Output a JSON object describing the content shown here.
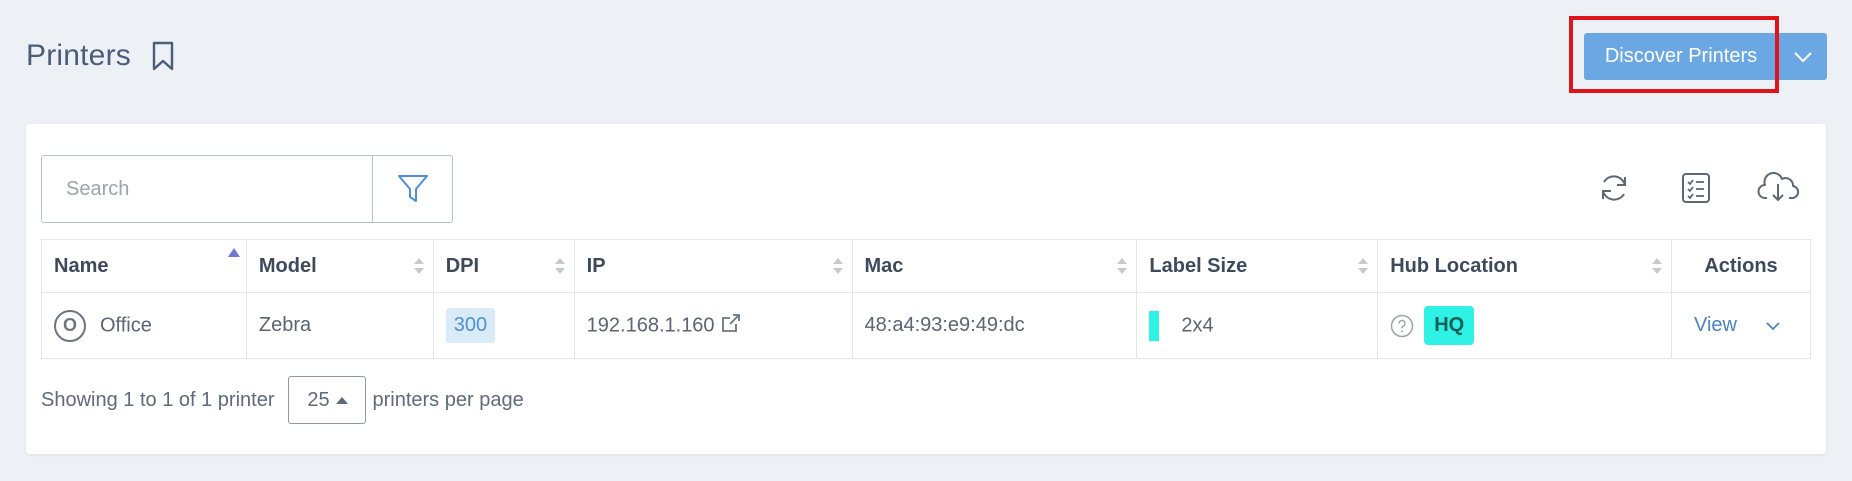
{
  "header": {
    "title": "Printers",
    "discover_label": "Discover Printers"
  },
  "search": {
    "placeholder": "Search"
  },
  "table": {
    "columns": {
      "name": "Name",
      "model": "Model",
      "dpi": "DPI",
      "ip": "IP",
      "mac": "Mac",
      "label_size": "Label Size",
      "hub_location": "Hub Location",
      "actions": "Actions"
    },
    "rows": [
      {
        "status": "O",
        "name": "Office",
        "model": "Zebra",
        "dpi": "300",
        "ip": "192.168.1.160",
        "mac": "48:a4:93:e9:49:dc",
        "label_size": "2x4",
        "hub_location": "HQ",
        "action": "View"
      }
    ]
  },
  "footer": {
    "showing": "Showing 1 to 1 of 1 printer",
    "per_page_value": "25",
    "per_page_suffix": "printers per page"
  },
  "colors": {
    "primary_button": "#6ba8e3",
    "highlight": "#e0151b",
    "label_color": "#2ef2e3",
    "sort_active": "#6f78d6"
  },
  "icons": {
    "bookmark": "bookmark-icon",
    "filter": "filter-icon",
    "refresh": "refresh-icon",
    "checklist": "checklist-icon",
    "download": "cloud-download-icon",
    "external": "external-link-icon",
    "help": "question-circle-icon"
  }
}
